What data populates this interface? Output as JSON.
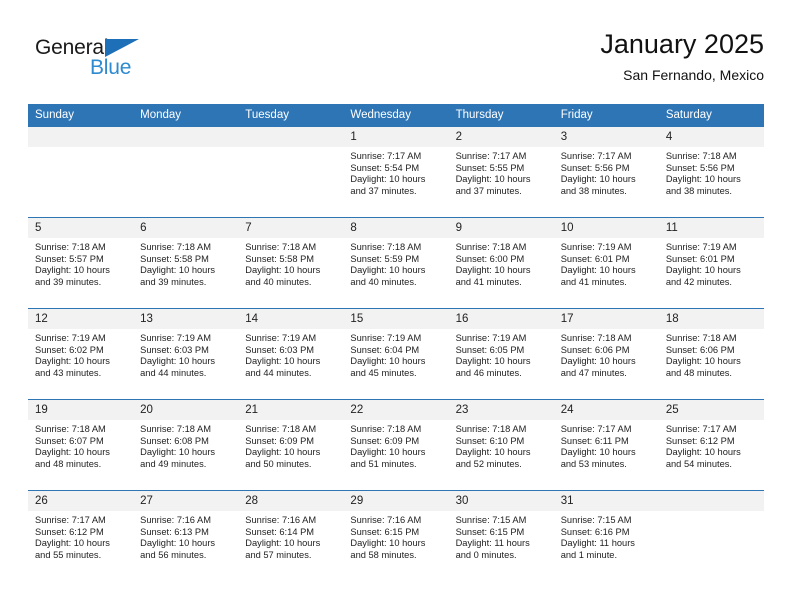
{
  "brand": {
    "name_part1": "General",
    "name_part2": "Blue",
    "flag_color": "#1D70B8",
    "blue_text_color": "#2E8BD0"
  },
  "header": {
    "title": "January 2025",
    "subtitle": "San Fernando, Mexico",
    "header_bg_color": "#2E75B6",
    "daynum_bg_color": "#F2F2F2"
  },
  "weekdays": [
    "Sunday",
    "Monday",
    "Tuesday",
    "Wednesday",
    "Thursday",
    "Friday",
    "Saturday"
  ],
  "labels": {
    "sunrise": "Sunrise:",
    "sunset": "Sunset:",
    "daylight": "Daylight:"
  },
  "weeks": [
    [
      {
        "day": "",
        "empty": true
      },
      {
        "day": "",
        "empty": true
      },
      {
        "day": "",
        "empty": true
      },
      {
        "day": "1",
        "sunrise": "Sunrise: 7:17 AM",
        "sunset": "Sunset: 5:54 PM",
        "daylight": "Daylight: 10 hours and 37 minutes."
      },
      {
        "day": "2",
        "sunrise": "Sunrise: 7:17 AM",
        "sunset": "Sunset: 5:55 PM",
        "daylight": "Daylight: 10 hours and 37 minutes."
      },
      {
        "day": "3",
        "sunrise": "Sunrise: 7:17 AM",
        "sunset": "Sunset: 5:56 PM",
        "daylight": "Daylight: 10 hours and 38 minutes."
      },
      {
        "day": "4",
        "sunrise": "Sunrise: 7:18 AM",
        "sunset": "Sunset: 5:56 PM",
        "daylight": "Daylight: 10 hours and 38 minutes."
      }
    ],
    [
      {
        "day": "5",
        "sunrise": "Sunrise: 7:18 AM",
        "sunset": "Sunset: 5:57 PM",
        "daylight": "Daylight: 10 hours and 39 minutes."
      },
      {
        "day": "6",
        "sunrise": "Sunrise: 7:18 AM",
        "sunset": "Sunset: 5:58 PM",
        "daylight": "Daylight: 10 hours and 39 minutes."
      },
      {
        "day": "7",
        "sunrise": "Sunrise: 7:18 AM",
        "sunset": "Sunset: 5:58 PM",
        "daylight": "Daylight: 10 hours and 40 minutes."
      },
      {
        "day": "8",
        "sunrise": "Sunrise: 7:18 AM",
        "sunset": "Sunset: 5:59 PM",
        "daylight": "Daylight: 10 hours and 40 minutes."
      },
      {
        "day": "9",
        "sunrise": "Sunrise: 7:18 AM",
        "sunset": "Sunset: 6:00 PM",
        "daylight": "Daylight: 10 hours and 41 minutes."
      },
      {
        "day": "10",
        "sunrise": "Sunrise: 7:19 AM",
        "sunset": "Sunset: 6:01 PM",
        "daylight": "Daylight: 10 hours and 41 minutes."
      },
      {
        "day": "11",
        "sunrise": "Sunrise: 7:19 AM",
        "sunset": "Sunset: 6:01 PM",
        "daylight": "Daylight: 10 hours and 42 minutes."
      }
    ],
    [
      {
        "day": "12",
        "sunrise": "Sunrise: 7:19 AM",
        "sunset": "Sunset: 6:02 PM",
        "daylight": "Daylight: 10 hours and 43 minutes."
      },
      {
        "day": "13",
        "sunrise": "Sunrise: 7:19 AM",
        "sunset": "Sunset: 6:03 PM",
        "daylight": "Daylight: 10 hours and 44 minutes."
      },
      {
        "day": "14",
        "sunrise": "Sunrise: 7:19 AM",
        "sunset": "Sunset: 6:03 PM",
        "daylight": "Daylight: 10 hours and 44 minutes."
      },
      {
        "day": "15",
        "sunrise": "Sunrise: 7:19 AM",
        "sunset": "Sunset: 6:04 PM",
        "daylight": "Daylight: 10 hours and 45 minutes."
      },
      {
        "day": "16",
        "sunrise": "Sunrise: 7:19 AM",
        "sunset": "Sunset: 6:05 PM",
        "daylight": "Daylight: 10 hours and 46 minutes."
      },
      {
        "day": "17",
        "sunrise": "Sunrise: 7:18 AM",
        "sunset": "Sunset: 6:06 PM",
        "daylight": "Daylight: 10 hours and 47 minutes."
      },
      {
        "day": "18",
        "sunrise": "Sunrise: 7:18 AM",
        "sunset": "Sunset: 6:06 PM",
        "daylight": "Daylight: 10 hours and 48 minutes."
      }
    ],
    [
      {
        "day": "19",
        "sunrise": "Sunrise: 7:18 AM",
        "sunset": "Sunset: 6:07 PM",
        "daylight": "Daylight: 10 hours and 48 minutes."
      },
      {
        "day": "20",
        "sunrise": "Sunrise: 7:18 AM",
        "sunset": "Sunset: 6:08 PM",
        "daylight": "Daylight: 10 hours and 49 minutes."
      },
      {
        "day": "21",
        "sunrise": "Sunrise: 7:18 AM",
        "sunset": "Sunset: 6:09 PM",
        "daylight": "Daylight: 10 hours and 50 minutes."
      },
      {
        "day": "22",
        "sunrise": "Sunrise: 7:18 AM",
        "sunset": "Sunset: 6:09 PM",
        "daylight": "Daylight: 10 hours and 51 minutes."
      },
      {
        "day": "23",
        "sunrise": "Sunrise: 7:18 AM",
        "sunset": "Sunset: 6:10 PM",
        "daylight": "Daylight: 10 hours and 52 minutes."
      },
      {
        "day": "24",
        "sunrise": "Sunrise: 7:17 AM",
        "sunset": "Sunset: 6:11 PM",
        "daylight": "Daylight: 10 hours and 53 minutes."
      },
      {
        "day": "25",
        "sunrise": "Sunrise: 7:17 AM",
        "sunset": "Sunset: 6:12 PM",
        "daylight": "Daylight: 10 hours and 54 minutes."
      }
    ],
    [
      {
        "day": "26",
        "sunrise": "Sunrise: 7:17 AM",
        "sunset": "Sunset: 6:12 PM",
        "daylight": "Daylight: 10 hours and 55 minutes."
      },
      {
        "day": "27",
        "sunrise": "Sunrise: 7:16 AM",
        "sunset": "Sunset: 6:13 PM",
        "daylight": "Daylight: 10 hours and 56 minutes."
      },
      {
        "day": "28",
        "sunrise": "Sunrise: 7:16 AM",
        "sunset": "Sunset: 6:14 PM",
        "daylight": "Daylight: 10 hours and 57 minutes."
      },
      {
        "day": "29",
        "sunrise": "Sunrise: 7:16 AM",
        "sunset": "Sunset: 6:15 PM",
        "daylight": "Daylight: 10 hours and 58 minutes."
      },
      {
        "day": "30",
        "sunrise": "Sunrise: 7:15 AM",
        "sunset": "Sunset: 6:15 PM",
        "daylight": "Daylight: 11 hours and 0 minutes."
      },
      {
        "day": "31",
        "sunrise": "Sunrise: 7:15 AM",
        "sunset": "Sunset: 6:16 PM",
        "daylight": "Daylight: 11 hours and 1 minute."
      },
      {
        "day": "",
        "empty": true
      }
    ]
  ]
}
